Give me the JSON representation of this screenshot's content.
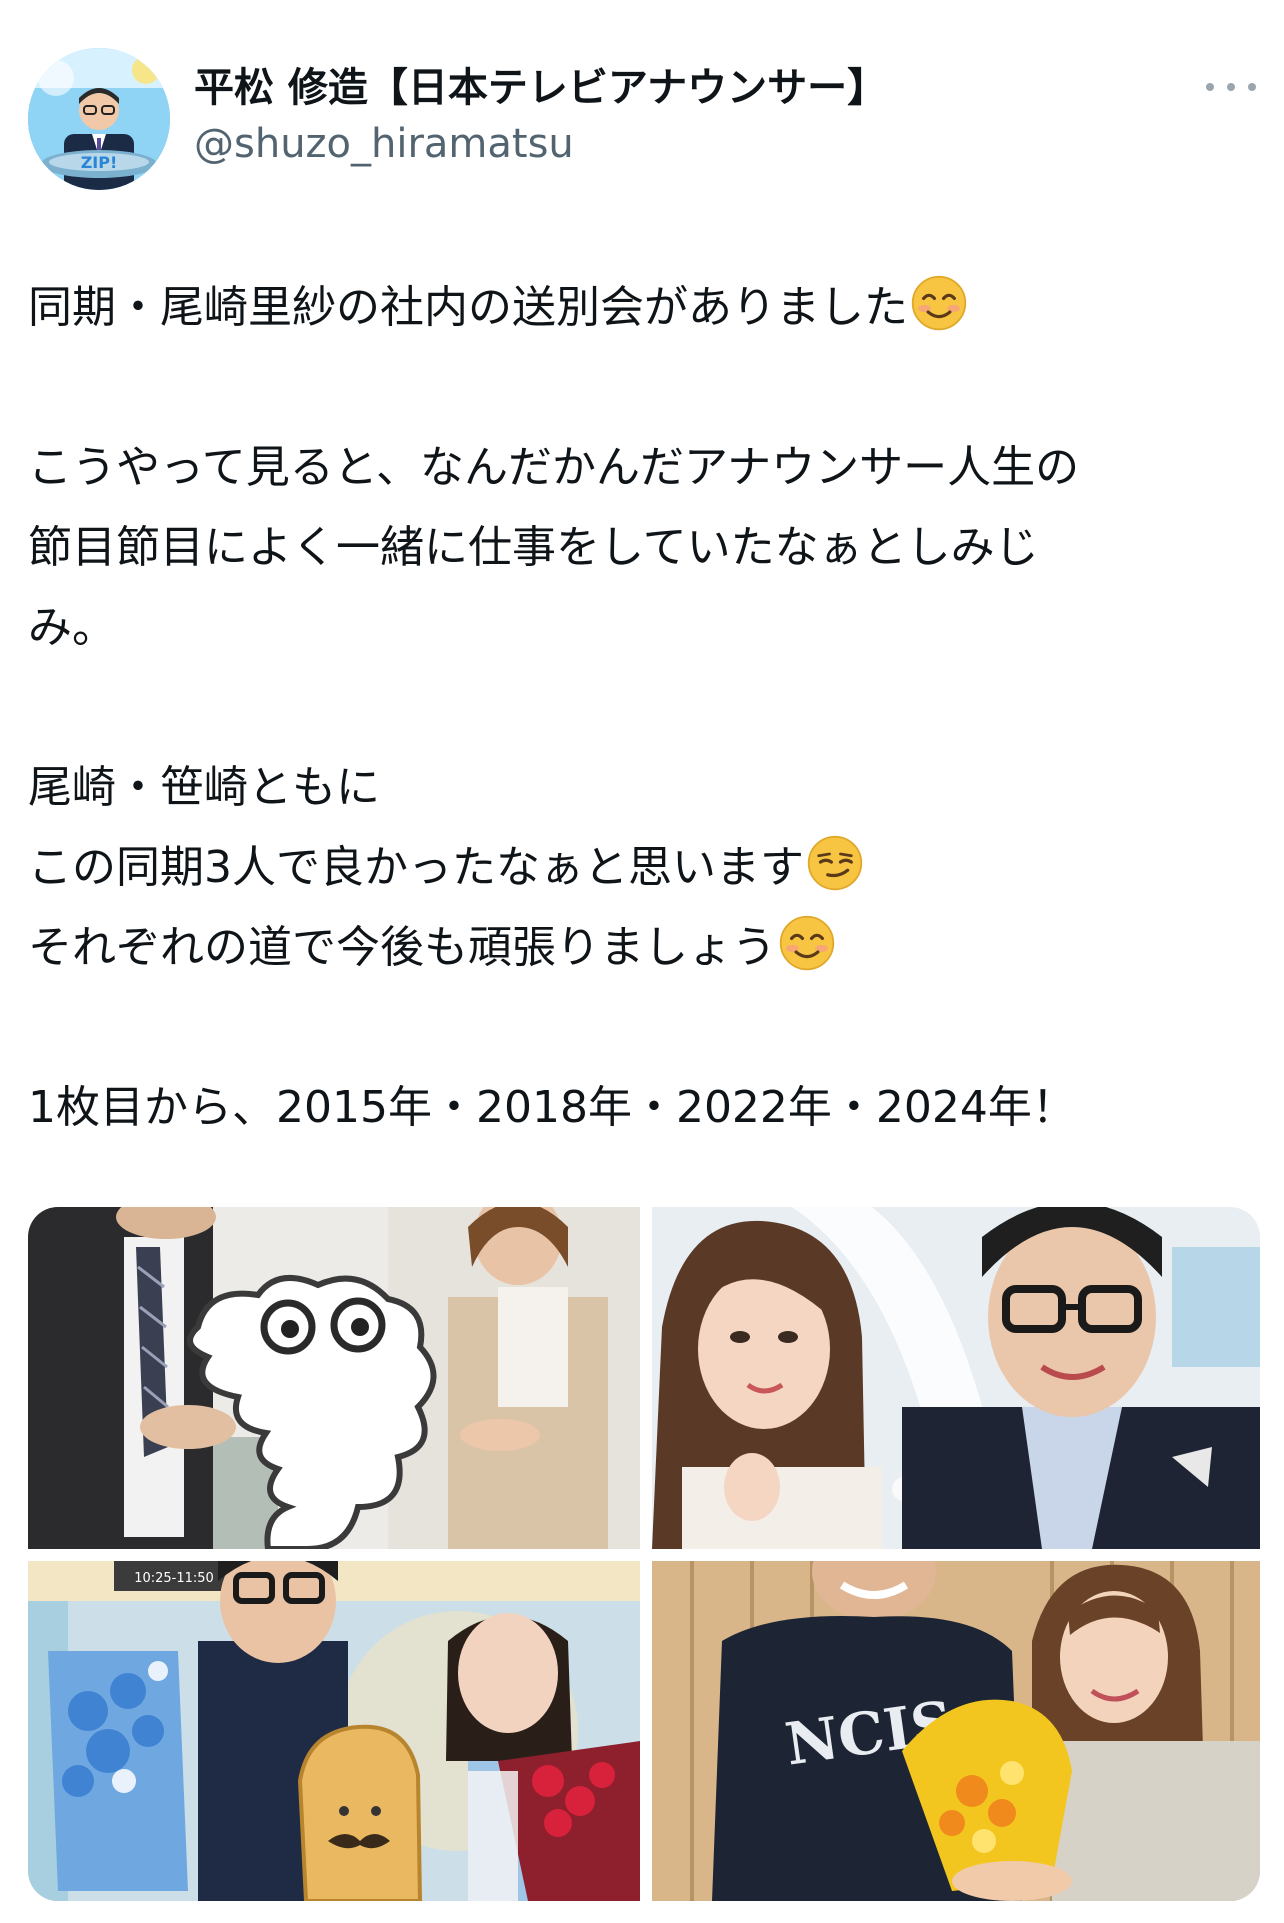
{
  "author": {
    "display_name": "平松 修造【日本テレビアナウンサー】",
    "handle": "@shuzo_hiramatsu",
    "avatar_icon": "profile-avatar"
  },
  "tweet": {
    "line1": "同期・尾崎里紗の社内の送別会がありました",
    "line2": "こうやって見ると、なんだかんだアナウンサー人生の",
    "line3": "節目節目によく一緒に仕事をしていたなぁとしみじ",
    "line4": "み。",
    "line5": "尾崎・笹崎ともに",
    "line6": "この同期3人で良かったなぁと思います",
    "line7": "それぞれの道で今後も頑張りましょう",
    "line8": "1枚目から、2015年・2018年・2022年・2024年！"
  },
  "media": {
    "photos": [
      {
        "alt": "photo-1"
      },
      {
        "alt": "photo-2"
      },
      {
        "alt": "photo-3"
      },
      {
        "alt": "photo-4"
      }
    ],
    "shirt_text": "NCIS",
    "clock_text": "10:25-11:50"
  },
  "colors": {
    "text": "#0f1419",
    "secondary": "#536471",
    "emoji_face": "#f7c542"
  }
}
